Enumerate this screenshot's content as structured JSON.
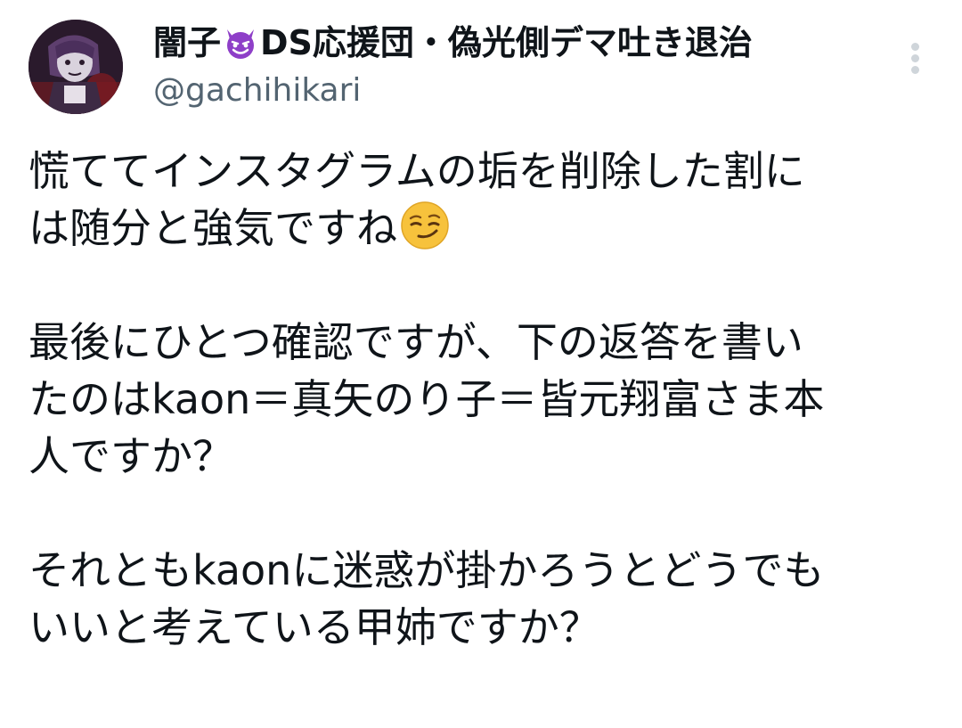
{
  "author": {
    "name_prefix": "闇子",
    "name_emoji": "smiling-devil-icon",
    "name_suffix": "DS応援団・偽光側デマ吐き退治",
    "handle": "@gachihikari"
  },
  "tweet": {
    "line1": "慌ててインスタグラムの垢を削除した割に",
    "line2": "は随分と強気ですね",
    "line2_emoji": "smirking-face-icon",
    "para2_line1": "最後にひとつ確認ですが、下の返答を書い",
    "para2_line2": "たのはkaon＝真矢のり子＝皆元翔富さま本",
    "para2_line3": "人ですか？",
    "para3_line1": "それともkaonに迷惑が掛かろうとどうでも",
    "para3_line2": "いいと考えている甲姉ですか？"
  },
  "colors": {
    "text": "#0f1419",
    "secondary": "#536471",
    "devil_purple": "#8e3fc8",
    "emoji_yellow": "#f7c23c"
  }
}
